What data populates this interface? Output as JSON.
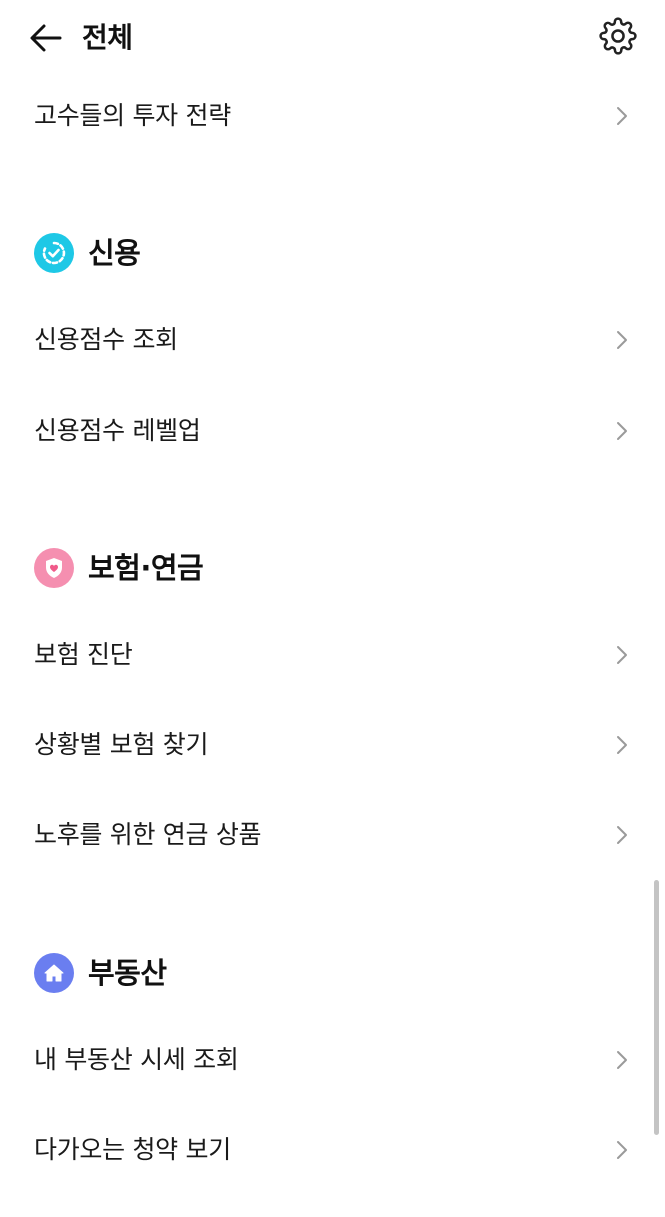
{
  "header": {
    "title": "전체",
    "back_icon": "arrow-left-icon",
    "settings_icon": "gear-icon"
  },
  "items_top": [
    {
      "label": "고수들의 투자 전략"
    }
  ],
  "sections": [
    {
      "title": "신용",
      "icon": "credit-check-icon",
      "icon_color": "#1ec8e6",
      "items": [
        {
          "label": "신용점수 조회"
        },
        {
          "label": "신용점수 레벨업"
        }
      ]
    },
    {
      "title": "보험·연금",
      "icon": "heart-shield-icon",
      "icon_color": "#f58fb0",
      "items": [
        {
          "label": "보험 진단"
        },
        {
          "label": "상황별 보험 찾기"
        },
        {
          "label": "노후를 위한 연금 상품"
        }
      ]
    },
    {
      "title": "부동산",
      "icon": "house-icon",
      "icon_color": "#6a7ef0",
      "items": [
        {
          "label": "내 부동산 시세 조회"
        },
        {
          "label": "다가오는 청약 보기"
        }
      ]
    }
  ],
  "chevron_icon": "chevron-right-icon"
}
